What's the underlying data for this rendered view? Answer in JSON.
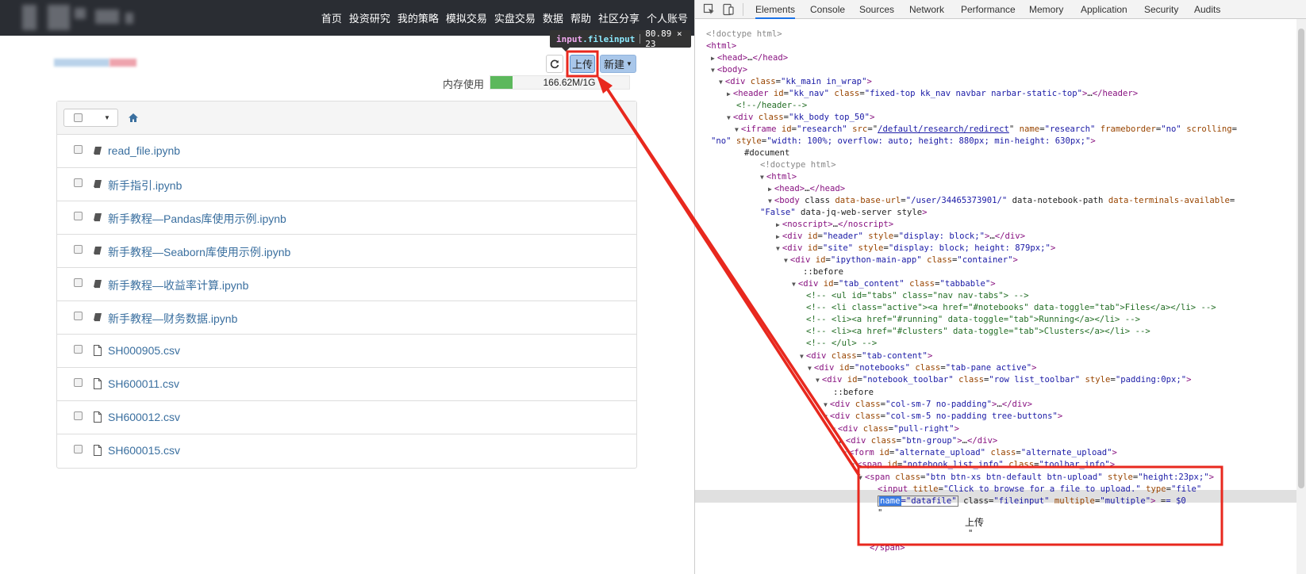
{
  "nav": {
    "links": [
      "首页",
      "投资研究",
      "我的策略",
      "模拟交易",
      "实盘交易",
      "数据",
      "帮助",
      "社区分享",
      "个人账号"
    ]
  },
  "toolbar": {
    "upload_label": "上传",
    "new_label": "新建",
    "memory_label": "内存使用",
    "memory_text": "166.62M/1G",
    "memory_fraction": 0.162
  },
  "files": [
    {
      "name": "read_file.ipynb",
      "type": "notebook"
    },
    {
      "name": "新手指引.ipynb",
      "type": "notebook"
    },
    {
      "name": "新手教程—Pandas库使用示例.ipynb",
      "type": "notebook"
    },
    {
      "name": "新手教程—Seaborn库使用示例.ipynb",
      "type": "notebook"
    },
    {
      "name": "新手教程—收益率计算.ipynb",
      "type": "notebook"
    },
    {
      "name": "新手教程—财务数据.ipynb",
      "type": "notebook"
    },
    {
      "name": "SH000905.csv",
      "type": "file"
    },
    {
      "name": "SH600011.csv",
      "type": "file"
    },
    {
      "name": "SH600012.csv",
      "type": "file"
    },
    {
      "name": "SH600015.csv",
      "type": "file"
    }
  ],
  "tooltip": {
    "tag": "input",
    "cls": ".fileinput",
    "size": "80.89 × 23"
  },
  "devtools": {
    "tabs": [
      "Elements",
      "Console",
      "Sources",
      "Network",
      "Performance",
      "Memory",
      "Application",
      "Security",
      "Audits"
    ],
    "active_tab": "Elements",
    "lines": [
      "<!doctype html>",
      "<html>",
      "<head>…</head>",
      "<body>",
      "<div class=\"kk_main in_wrap\">",
      "<header id=\"kk_nav\" class=\"fixed-top kk_nav navbar narbar-static-top\">…</header>",
      "<!--/header-->",
      "<div class=\"kk_body top_50\">",
      "<iframe id=\"research\" src=\"/default/research/redirect\" name=\"research\" frameborder=\"no\" scrolling=",
      "\"no\" style=\"width: 100%; overflow: auto; height: 880px; min-height: 630px;\">",
      "#document",
      "<!doctype html>",
      "<html>",
      "<head>…</head>",
      "<body class data-base-url=\"/user/34465373901/\" data-notebook-path data-terminals-available=",
      "\"False\" data-jq-web-server style>",
      "<noscript>…</noscript>",
      "<div id=\"header\" style=\"display: block;\">…</div>",
      "<div id=\"site\" style=\"display: block; height: 879px;\">",
      "<div id=\"ipython-main-app\" class=\"container\">",
      "::before",
      "<div id=\"tab_content\" class=\"tabbable\">",
      "<!-- <ul id=\"tabs\" class=\"nav nav-tabs\"> -->",
      "<!-- <li class=\"active\"><a href=\"#notebooks\" data-toggle=\"tab\">Files</a></li> -->",
      "<!-- <li><a href=\"#running\" data-toggle=\"tab\">Running</a></li> -->",
      "<!-- <li><a href=\"#clusters\" data-toggle=\"tab\">Clusters</a></li> -->",
      "<!-- </ul> -->",
      "<div class=\"tab-content\">",
      "<div id=\"notebooks\" class=\"tab-pane active\">",
      "<div id=\"notebook_toolbar\" class=\"row list_toolbar\" style=\"padding:0px;\">",
      "::before",
      "<div class=\"col-sm-7 no-padding\">…</div>",
      "<div class=\"col-sm-5 no-padding tree-buttons\">",
      "<div class=\"pull-right\">",
      "<div class=\"btn-group\">…</div>",
      "<form id=\"alternate_upload\" class=\"alternate_upload\">",
      "<span id=\"notebook_list_info\" class=\"toolbar_info\">",
      "<span class=\"btn btn-xs btn-default btn-upload\" style=\"height:23px;\">",
      "<input title=\"Click to browse for a file to upload.\" type=\"file\"",
      "class=\"fileinput\" multiple=\"multiple\"> == $0",
      "\"",
      "上传",
      "\"",
      "</span>"
    ],
    "selected_attr": "name",
    "selected_value": "=\"datafile\""
  }
}
